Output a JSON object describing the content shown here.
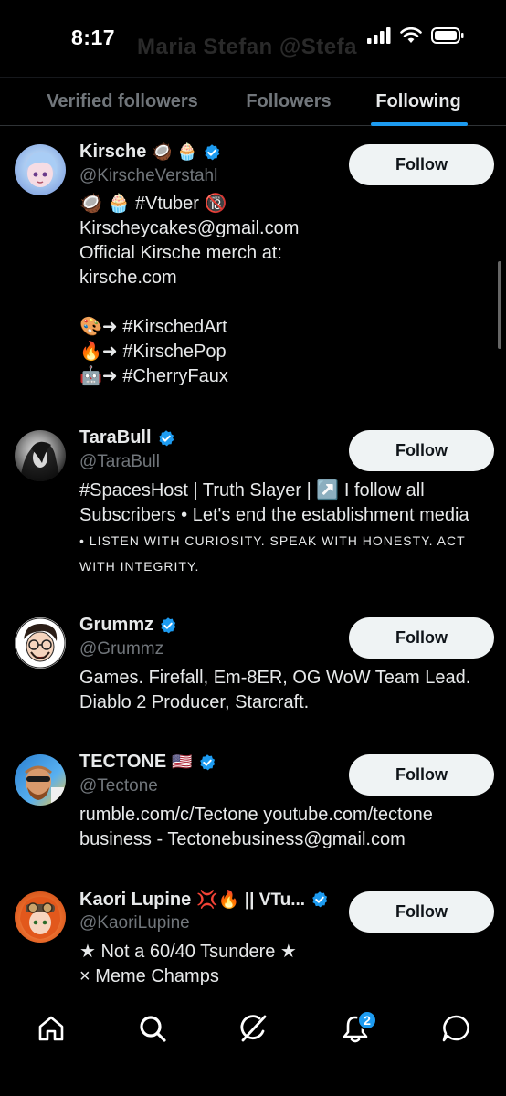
{
  "status_bar": {
    "time": "8:17",
    "ghost_title": "Maria Stefan @Stefa"
  },
  "tabs": [
    {
      "label": "Verified followers",
      "active": false
    },
    {
      "label": "Followers",
      "active": false
    },
    {
      "label": "Following",
      "active": true
    }
  ],
  "accent_color": "#1d9bf0",
  "users": [
    {
      "name": "Kirsche",
      "name_emoji": "🥥 🧁",
      "handle": "@KirscheVerstahl",
      "follow_label": "Follow",
      "bio": [
        "🥥 🧁 #Vtuber 🔞",
        "Kirscheycakes@gmail.com",
        "Official Kirsche merch at:",
        "kirsche.com",
        "",
        "🎨➜ #KirschedArt",
        "🔥➜ #KirschePop",
        "🤖➜ #CherryFaux"
      ]
    },
    {
      "name": "TaraBull",
      "name_emoji": "",
      "handle": "@TaraBull",
      "follow_label": "Follow",
      "bio": [
        "#SpacesHost | Truth Slayer | ↗️ I follow all",
        "Subscribers • Let's end the establishment media"
      ],
      "bio_caps": [
        "• LISTEN WITH CURIOSITY. SPEAK WITH HONESTY. ACT",
        "WITH INTEGRITY."
      ]
    },
    {
      "name": "Grummz",
      "name_emoji": "",
      "handle": "@Grummz",
      "follow_label": "Follow",
      "bio": [
        "Games. Firefall, Em-8ER, OG WoW Team Lead.",
        "Diablo 2 Producer, Starcraft."
      ]
    },
    {
      "name": "TECTONE",
      "name_emoji": "🇺🇸",
      "handle": "@Tectone",
      "follow_label": "Follow",
      "bio": [
        "rumble.com/c/Tectone youtube.com/tectone",
        "business - Tectonebusiness@gmail.com"
      ]
    },
    {
      "name": "Kaori Lupine",
      "name_emoji": "💢🔥 || VTu...",
      "handle": "@KaoriLupine",
      "follow_label": "Follow",
      "bio": [
        "★ Not a 60/40 Tsundere ★",
        "× Meme Champs"
      ]
    }
  ],
  "bottom_nav": {
    "items": [
      "home-icon",
      "search-icon",
      "grok-icon",
      "notifications-icon",
      "messages-icon"
    ],
    "notification_count": "2"
  }
}
